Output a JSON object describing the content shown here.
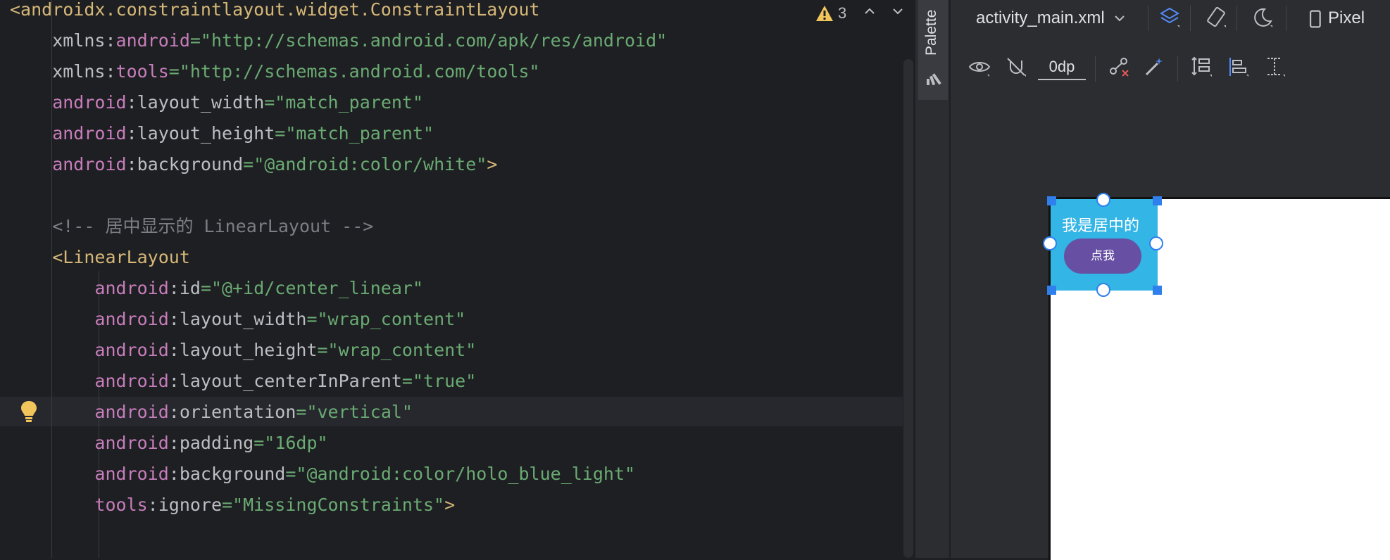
{
  "editor": {
    "lines": [
      {
        "parts": [
          [
            "tag",
            "<androidx.constraintlayout.widget.ConstraintLayout"
          ]
        ]
      },
      {
        "parts": [
          [
            "punct",
            "    xmlns:"
          ],
          [
            "attr-ns",
            "android"
          ],
          [
            "str",
            "=\"http://schemas.android.com/apk/res/android\""
          ]
        ]
      },
      {
        "parts": [
          [
            "punct",
            "    xmlns:"
          ],
          [
            "attr-ns",
            "tools"
          ],
          [
            "str",
            "=\"http://schemas.android.com/tools\""
          ]
        ]
      },
      {
        "parts": [
          [
            "attr-ns",
            "    android"
          ],
          [
            "punct",
            ":layout_width"
          ],
          [
            "str",
            "=\"match_parent\""
          ]
        ]
      },
      {
        "parts": [
          [
            "attr-ns",
            "    android"
          ],
          [
            "punct",
            ":layout_height"
          ],
          [
            "str",
            "=\"match_parent\""
          ]
        ]
      },
      {
        "parts": [
          [
            "attr-ns",
            "    android"
          ],
          [
            "punct",
            ":background"
          ],
          [
            "str",
            "=\"@android:color/white\""
          ],
          [
            "tag",
            ">"
          ]
        ]
      },
      {
        "parts": [
          [
            "punct",
            ""
          ]
        ]
      },
      {
        "parts": [
          [
            "comment",
            "    <!-- 居中显示的 LinearLayout -->"
          ]
        ]
      },
      {
        "parts": [
          [
            "tag",
            "    <LinearLayout"
          ]
        ]
      },
      {
        "parts": [
          [
            "attr-ns",
            "        android"
          ],
          [
            "punct",
            ":id"
          ],
          [
            "str",
            "=\"@+id/center_linear\""
          ]
        ]
      },
      {
        "parts": [
          [
            "attr-ns",
            "        android"
          ],
          [
            "punct",
            ":layout_width"
          ],
          [
            "str",
            "=\"wrap_content\""
          ]
        ]
      },
      {
        "parts": [
          [
            "attr-ns",
            "        android"
          ],
          [
            "punct",
            ":layout_height"
          ],
          [
            "str",
            "=\"wrap_content\""
          ]
        ]
      },
      {
        "parts": [
          [
            "attr-ns",
            "        android"
          ],
          [
            "punct",
            ":layout_centerInParent"
          ],
          [
            "str",
            "=\"true\""
          ]
        ]
      },
      {
        "parts": [
          [
            "attr-ns",
            "        android"
          ],
          [
            "punct",
            ":orientation"
          ],
          [
            "str",
            "=\"vertical\""
          ]
        ]
      },
      {
        "parts": [
          [
            "attr-ns",
            "        android"
          ],
          [
            "punct",
            ":padding"
          ],
          [
            "str",
            "=\"16dp\""
          ]
        ]
      },
      {
        "parts": [
          [
            "attr-ns",
            "        android"
          ],
          [
            "punct",
            ":background"
          ],
          [
            "str",
            "=\"@android:color/holo_blue_light\""
          ]
        ]
      },
      {
        "parts": [
          [
            "attr-ns",
            "        tools"
          ],
          [
            "punct",
            ":ignore"
          ],
          [
            "str",
            "=\"MissingConstraints\""
          ],
          [
            "tag",
            ">"
          ]
        ]
      }
    ],
    "warning_count": "3",
    "colors": {
      "tag": "#d5b778",
      "attr": "#c77dbb",
      "string": "#6aab73",
      "comment": "#7a7e85"
    }
  },
  "sidebar": {
    "palette_label": "Palette"
  },
  "designer": {
    "file_name": "activity_main.xml",
    "device_label": "Pixel",
    "margin_value": "0dp"
  },
  "preview": {
    "linear_text": "我是居中的",
    "button_label": "点我",
    "linear_bg": "#33b5e5",
    "button_bg": "#6750a4"
  }
}
